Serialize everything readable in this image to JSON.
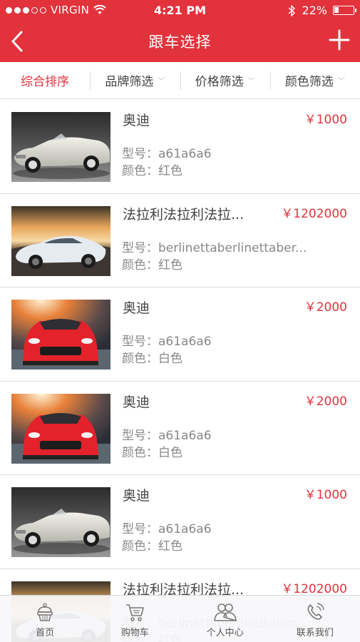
{
  "status_bar": {
    "carrier": "VIRGIN",
    "time": "4:21 PM",
    "battery": "22%",
    "battery_level": 0.22
  },
  "nav": {
    "title": "跟车选择",
    "back_icon": "chevron-left-icon",
    "add_icon": "plus-icon"
  },
  "filters": [
    {
      "label": "综合排序",
      "active": true
    },
    {
      "label": "品牌筛选",
      "active": false
    },
    {
      "label": "价格筛选",
      "active": false
    },
    {
      "label": "颜色筛选",
      "active": false
    }
  ],
  "cars": [
    {
      "name": "奥迪",
      "price": "￥1000",
      "model": "型号：a61a6a6",
      "color": "颜色：红色",
      "image": "silver-convertible"
    },
    {
      "name": "法拉利法拉利法拉...",
      "price": "￥1202000",
      "model": "型号：berlinettaberlinettaber...",
      "color": "颜色：红色",
      "image": "white-sedan"
    },
    {
      "name": "奥迪",
      "price": "￥2000",
      "model": "型号：a61a6a6",
      "color": "颜色：白色",
      "image": "red-sports-car"
    },
    {
      "name": "奥迪",
      "price": "￥2000",
      "model": "型号：a61a6a6",
      "color": "颜色：白色",
      "image": "red-sports-car"
    },
    {
      "name": "奥迪",
      "price": "￥1000",
      "model": "型号：a61a6a6",
      "color": "颜色：红色",
      "image": "silver-convertible"
    },
    {
      "name": "法拉利法拉利法拉...",
      "price": "￥1202000",
      "model": "型号：berlinettaberlinettaber...",
      "color": "颜色：红色",
      "image": "white-sedan"
    }
  ],
  "tabs": [
    {
      "label": "首页",
      "icon": "cake-icon"
    },
    {
      "label": "购物车",
      "icon": "cart-icon"
    },
    {
      "label": "个人中心",
      "icon": "people-icon"
    },
    {
      "label": "联系我们",
      "icon": "phone-icon"
    }
  ],
  "colors": {
    "brand": "#e2323c",
    "price": "#e2323c"
  }
}
